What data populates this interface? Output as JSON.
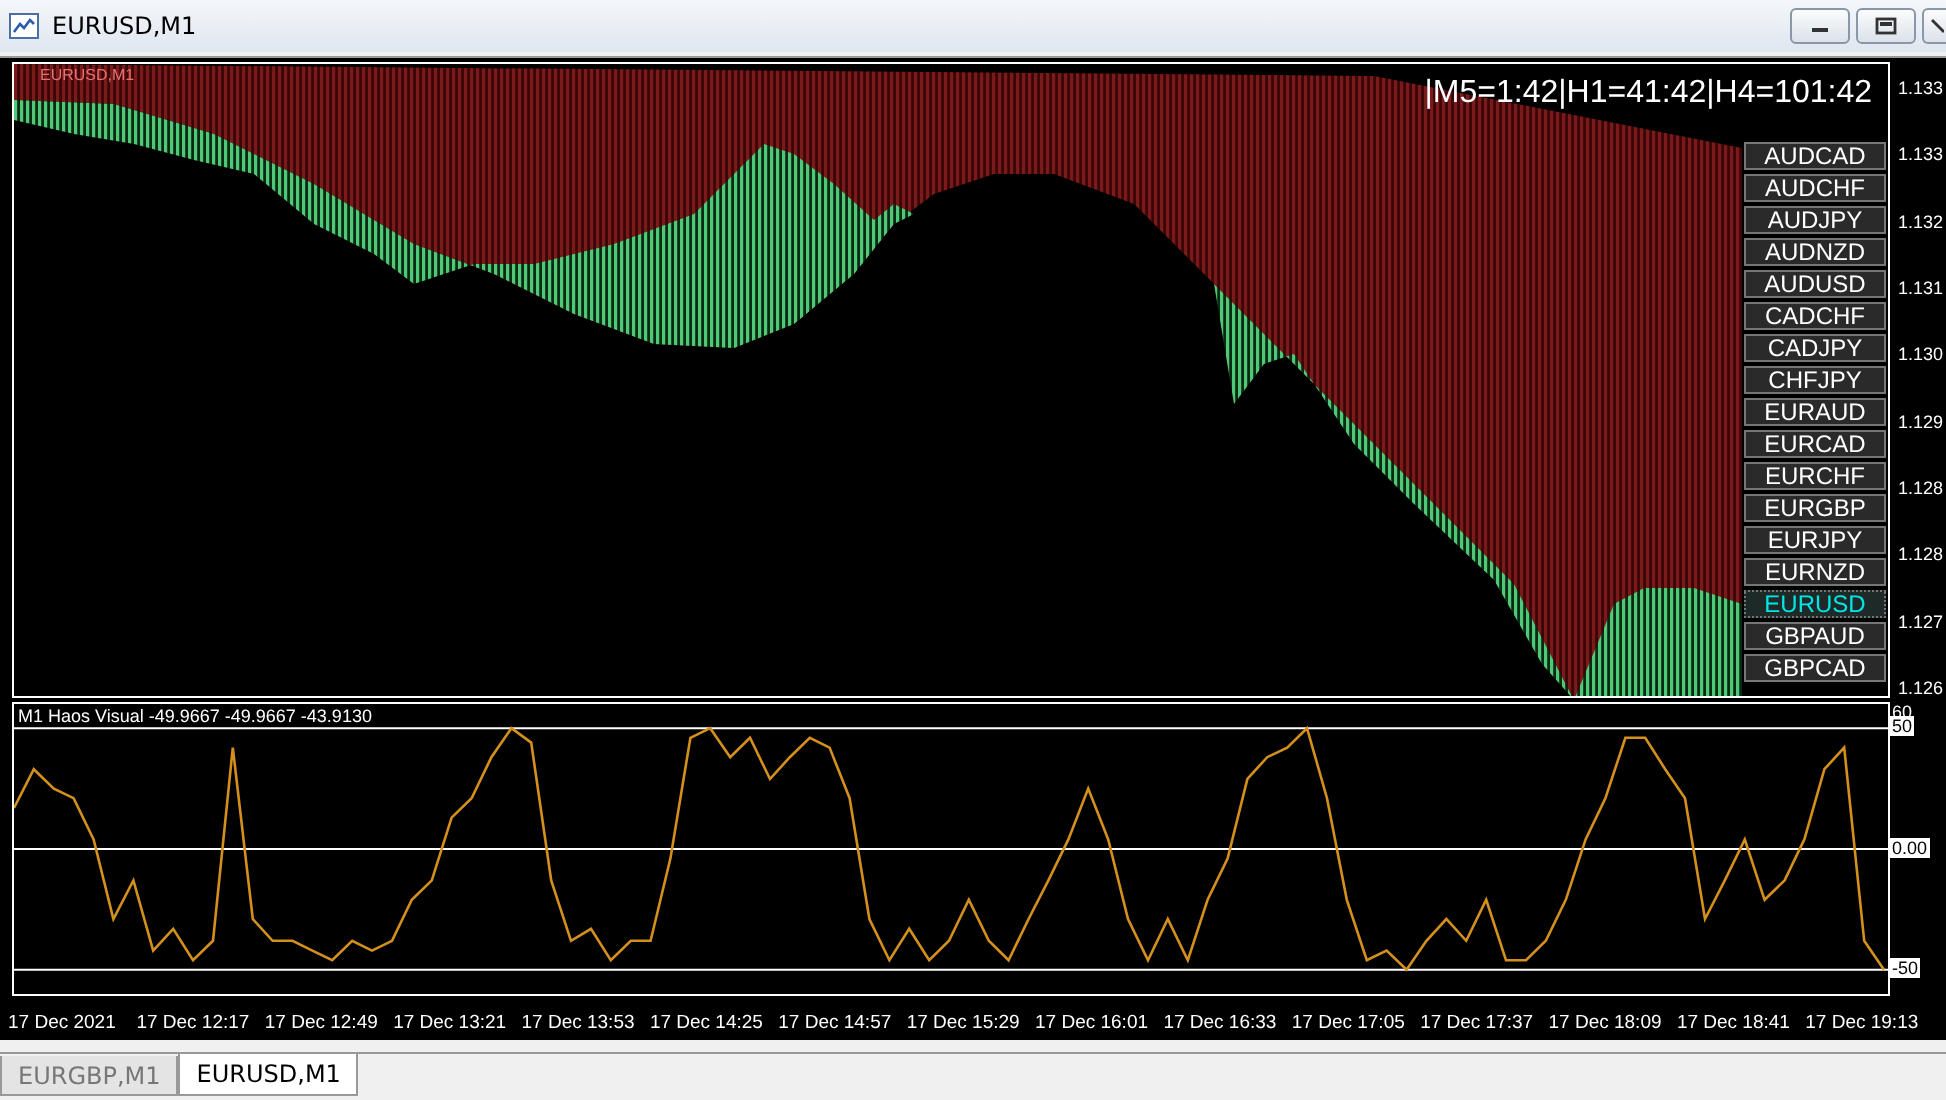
{
  "window": {
    "title": "EURUSD,M1"
  },
  "chart": {
    "symbol_label": "EURUSD,M1",
    "timer": "|M5=1:42|H1=41:42|H4=101:42",
    "price_axis": [
      "1.133",
      "1.133",
      "1.132",
      "1.131",
      "1.130",
      "1.129",
      "1.128",
      "1.128",
      "1.127",
      "1.126"
    ],
    "symbols": [
      {
        "label": "AUDCAD",
        "selected": false
      },
      {
        "label": "AUDCHF",
        "selected": false
      },
      {
        "label": "AUDJPY",
        "selected": false
      },
      {
        "label": "AUDNZD",
        "selected": false
      },
      {
        "label": "AUDUSD",
        "selected": false
      },
      {
        "label": "CADCHF",
        "selected": false
      },
      {
        "label": "CADJPY",
        "selected": false
      },
      {
        "label": "CHFJPY",
        "selected": false
      },
      {
        "label": "EURAUD",
        "selected": false
      },
      {
        "label": "EURCAD",
        "selected": false
      },
      {
        "label": "EURCHF",
        "selected": false
      },
      {
        "label": "EURGBP",
        "selected": false
      },
      {
        "label": "EURJPY",
        "selected": false
      },
      {
        "label": "EURNZD",
        "selected": false
      },
      {
        "label": "EURUSD",
        "selected": true
      },
      {
        "label": "GBPAUD",
        "selected": false
      },
      {
        "label": "GBPCAD",
        "selected": false
      }
    ]
  },
  "indicator": {
    "label": "M1 Haos Visual -49.9667 -49.9667 -43.9130",
    "chart_data": {
      "type": "line",
      "ylim": [
        -60,
        60
      ],
      "yticks": [
        {
          "value": 60,
          "label": "60"
        },
        {
          "value": 50,
          "label": "50"
        },
        {
          "value": 0,
          "label": "0.00"
        },
        {
          "value": -50,
          "label": "-50"
        }
      ],
      "grid": true,
      "values": [
        17,
        33,
        25,
        21,
        4,
        -29,
        -13,
        -42,
        -33,
        -46,
        -38,
        42,
        -29,
        -38,
        -38,
        -42,
        -46,
        -38,
        -42,
        -38,
        -21,
        -13,
        13,
        21,
        38,
        50,
        44,
        -13,
        -38,
        -33,
        -46,
        -38,
        -38,
        -4,
        46,
        50,
        38,
        46,
        29,
        38,
        46,
        42,
        21,
        -29,
        -46,
        -33,
        -46,
        -38,
        -21,
        -38,
        -46,
        -29,
        -13,
        4,
        25,
        4,
        -29,
        -46,
        -29,
        -46,
        -21,
        -4,
        29,
        38,
        42,
        50,
        21,
        -21,
        -46,
        -42,
        -50,
        -38,
        -29,
        -38,
        -21,
        -46,
        -46,
        -38,
        -21,
        4,
        21,
        46,
        46,
        33,
        21,
        -29,
        -13,
        4,
        -21,
        -13,
        4,
        33,
        42,
        -38,
        -50
      ]
    }
  },
  "time_axis": [
    "17 Dec 2021",
    "17 Dec 12:17",
    "17 Dec 12:49",
    "17 Dec 13:21",
    "17 Dec 13:53",
    "17 Dec 14:25",
    "17 Dec 14:57",
    "17 Dec 15:29",
    "17 Dec 16:01",
    "17 Dec 16:33",
    "17 Dec 17:05",
    "17 Dec 17:37",
    "17 Dec 18:09",
    "17 Dec 18:41",
    "17 Dec 19:13"
  ],
  "tabs": [
    {
      "label": "EURGBP,M1",
      "selected": false
    },
    {
      "label": "EURUSD,M1",
      "selected": true
    }
  ]
}
